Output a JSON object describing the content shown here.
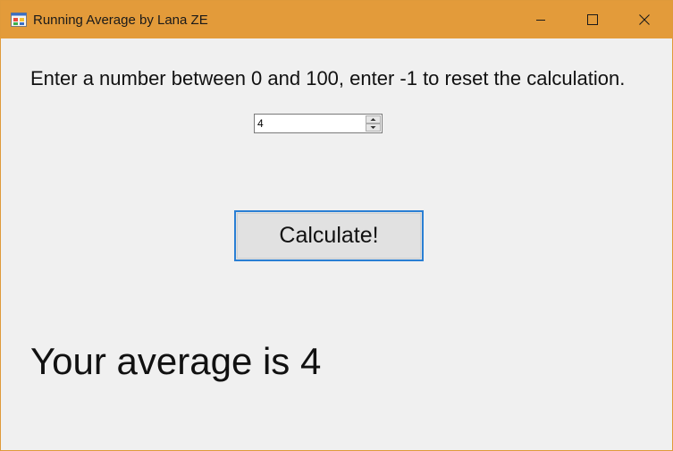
{
  "window": {
    "title": "Running Average by Lana ZE",
    "titlebar_color": "#e39b3a",
    "icons": {
      "app": "app-icon",
      "minimize": "minimize-icon",
      "maximize": "maximize-icon",
      "close": "close-icon"
    }
  },
  "main": {
    "prompt": "Enter a number between 0 and 100, enter -1 to reset the calculation.",
    "number_input": {
      "value": "4"
    },
    "calculate_label": "Calculate!",
    "result_text": "Your average is 4"
  },
  "colors": {
    "background": "#f0f0f0",
    "button_focus_border": "#2a7fd4"
  }
}
